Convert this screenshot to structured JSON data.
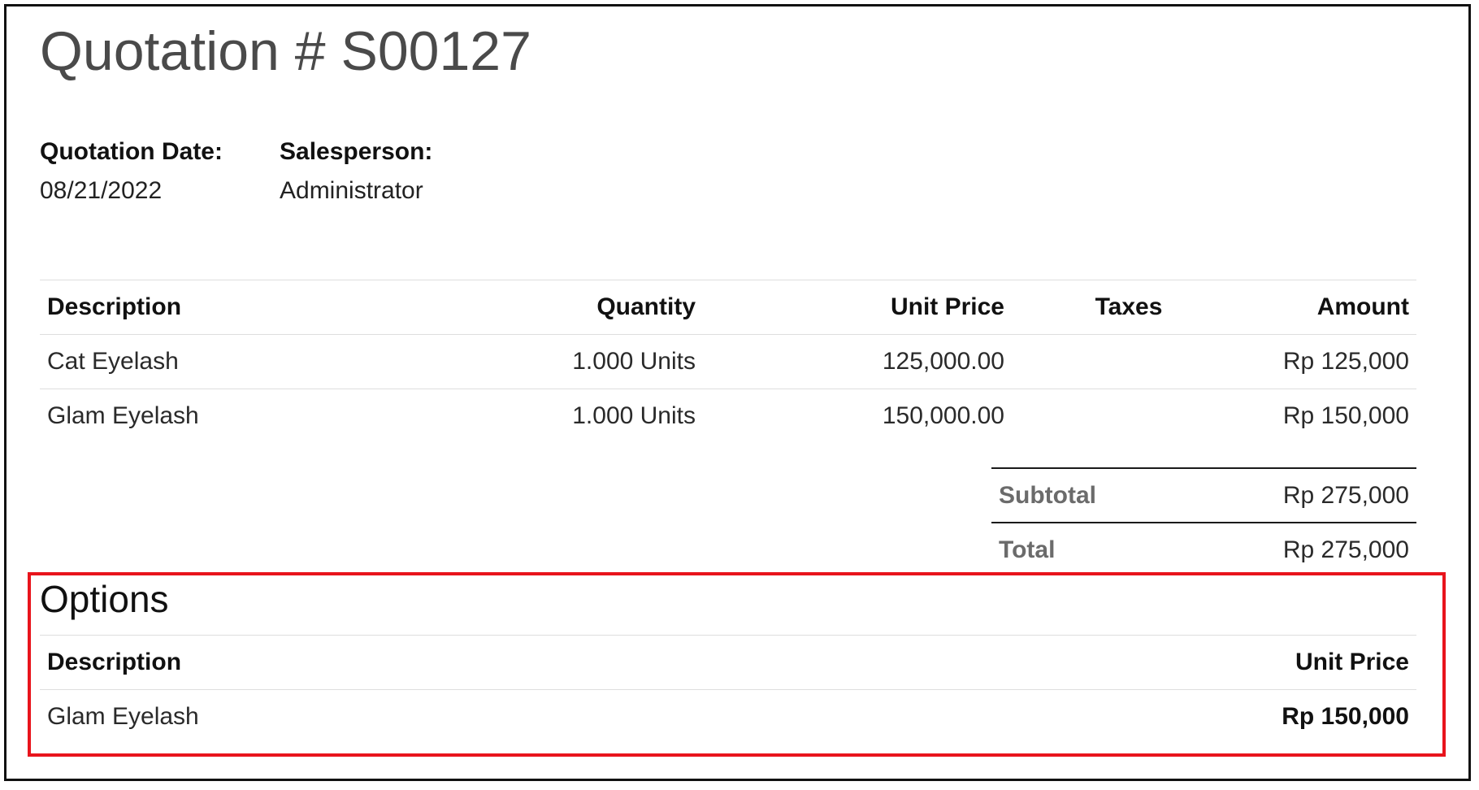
{
  "title": "Quotation # S00127",
  "info": {
    "date_label": "Quotation Date:",
    "date_value": "08/21/2022",
    "salesperson_label": "Salesperson:",
    "salesperson_value": "Administrator"
  },
  "lines": {
    "headers": {
      "description": "Description",
      "quantity": "Quantity",
      "unit_price": "Unit Price",
      "taxes": "Taxes",
      "amount": "Amount"
    },
    "rows": [
      {
        "description": "Cat Eyelash",
        "quantity": "1.000 Units",
        "unit_price": "125,000.00",
        "taxes": "",
        "amount": "Rp 125,000"
      },
      {
        "description": "Glam Eyelash",
        "quantity": "1.000 Units",
        "unit_price": "150,000.00",
        "taxes": "",
        "amount": "Rp 150,000"
      }
    ]
  },
  "totals": {
    "subtotal_label": "Subtotal",
    "subtotal_value": "Rp 275,000",
    "total_label": "Total",
    "total_value": "Rp 275,000"
  },
  "options": {
    "title": "Options",
    "headers": {
      "description": "Description",
      "unit_price": "Unit Price"
    },
    "rows": [
      {
        "description": "Glam Eyelash",
        "unit_price": "Rp 150,000"
      }
    ]
  },
  "colors": {
    "highlight_border": "#e8141c",
    "title_text": "#4a4a4a",
    "muted_label": "#6b6b6b"
  }
}
